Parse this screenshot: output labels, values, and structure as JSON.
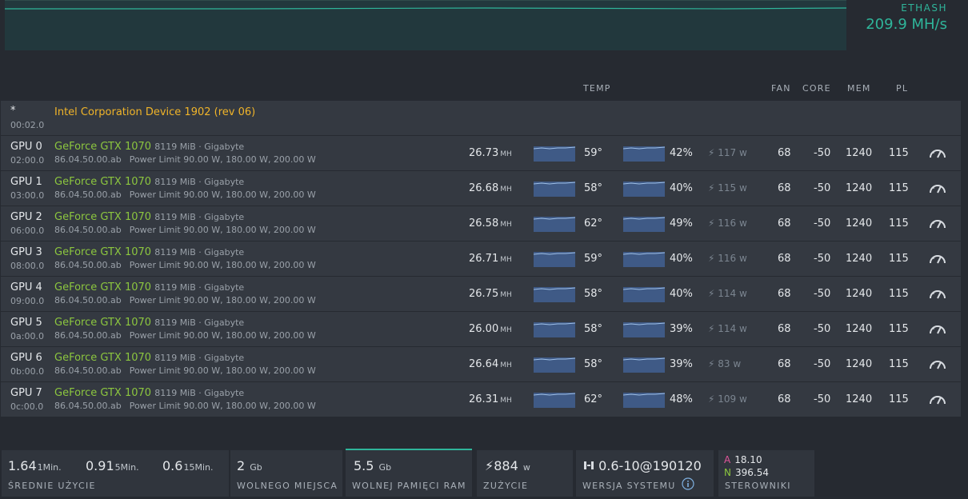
{
  "algo": {
    "name": "ETHASH",
    "hashrate": "209.9 MH/s"
  },
  "columns": {
    "temp": "TEMP",
    "fan": "FAN",
    "core": "CORE",
    "mem": "MEM",
    "pl": "PL"
  },
  "cpu_row": {
    "id": "*",
    "bus": "00:02.0",
    "name": "Intel Corporation Device 1902 (rev 06)"
  },
  "gpus": [
    {
      "id": "GPU 0",
      "bus": "02:00.0",
      "model": "GeForce GTX 1070",
      "mem": "8119 MiB · Gigabyte",
      "bios": "86.04.50.00.ab",
      "power_limit": "Power Limit 90.00 W, 180.00 W, 200.00 W",
      "hashrate": "26.73",
      "unit": "MH",
      "temp": "59°",
      "fan_pct": "42%",
      "power": "117 w",
      "fan": "68",
      "core": "-50",
      "mem_clk": "1240",
      "pl": "115"
    },
    {
      "id": "GPU 1",
      "bus": "03:00.0",
      "model": "GeForce GTX 1070",
      "mem": "8119 MiB · Gigabyte",
      "bios": "86.04.50.00.ab",
      "power_limit": "Power Limit 90.00 W, 180.00 W, 200.00 W",
      "hashrate": "26.68",
      "unit": "MH",
      "temp": "58°",
      "fan_pct": "40%",
      "power": "115 w",
      "fan": "68",
      "core": "-50",
      "mem_clk": "1240",
      "pl": "115"
    },
    {
      "id": "GPU 2",
      "bus": "06:00.0",
      "model": "GeForce GTX 1070",
      "mem": "8119 MiB · Gigabyte",
      "bios": "86.04.50.00.ab",
      "power_limit": "Power Limit 90.00 W, 180.00 W, 200.00 W",
      "hashrate": "26.58",
      "unit": "MH",
      "temp": "62°",
      "fan_pct": "49%",
      "power": "116 w",
      "fan": "68",
      "core": "-50",
      "mem_clk": "1240",
      "pl": "115"
    },
    {
      "id": "GPU 3",
      "bus": "08:00.0",
      "model": "GeForce GTX 1070",
      "mem": "8119 MiB · Gigabyte",
      "bios": "86.04.50.00.ab",
      "power_limit": "Power Limit 90.00 W, 180.00 W, 200.00 W",
      "hashrate": "26.71",
      "unit": "MH",
      "temp": "59°",
      "fan_pct": "40%",
      "power": "116 w",
      "fan": "68",
      "core": "-50",
      "mem_clk": "1240",
      "pl": "115"
    },
    {
      "id": "GPU 4",
      "bus": "09:00.0",
      "model": "GeForce GTX 1070",
      "mem": "8119 MiB · Gigabyte",
      "bios": "86.04.50.00.ab",
      "power_limit": "Power Limit 90.00 W, 180.00 W, 200.00 W",
      "hashrate": "26.75",
      "unit": "MH",
      "temp": "58°",
      "fan_pct": "40%",
      "power": "114 w",
      "fan": "68",
      "core": "-50",
      "mem_clk": "1240",
      "pl": "115"
    },
    {
      "id": "GPU 5",
      "bus": "0a:00.0",
      "model": "GeForce GTX 1070",
      "mem": "8119 MiB · Gigabyte",
      "bios": "86.04.50.00.ab",
      "power_limit": "Power Limit 90.00 W, 180.00 W, 200.00 W",
      "hashrate": "26.00",
      "unit": "MH",
      "temp": "58°",
      "fan_pct": "39%",
      "power": "114 w",
      "fan": "68",
      "core": "-50",
      "mem_clk": "1240",
      "pl": "115"
    },
    {
      "id": "GPU 6",
      "bus": "0b:00.0",
      "model": "GeForce GTX 1070",
      "mem": "8119 MiB · Gigabyte",
      "bios": "86.04.50.00.ab",
      "power_limit": "Power Limit 90.00 W, 180.00 W, 200.00 W",
      "hashrate": "26.64",
      "unit": "MH",
      "temp": "58°",
      "fan_pct": "39%",
      "power": "83 w",
      "fan": "68",
      "core": "-50",
      "mem_clk": "1240",
      "pl": "115"
    },
    {
      "id": "GPU 7",
      "bus": "0c:00.0",
      "model": "GeForce GTX 1070",
      "mem": "8119 MiB · Gigabyte",
      "bios": "86.04.50.00.ab",
      "power_limit": "Power Limit 90.00 W, 180.00 W, 200.00 W",
      "hashrate": "26.31",
      "unit": "MH",
      "temp": "62°",
      "fan_pct": "48%",
      "power": "109 w",
      "fan": "68",
      "core": "-50",
      "mem_clk": "1240",
      "pl": "115"
    }
  ],
  "footer": {
    "load": {
      "v1": "1.64",
      "u1": "1Min.",
      "v5": "0.91",
      "u5": "5Min.",
      "v15": "0.6",
      "u15": "15Min.",
      "label": "ŚREDNIE UŻYCIE"
    },
    "disk": {
      "value": "2",
      "unit": "Gb",
      "label": "WOLNEGO MIEJSCA"
    },
    "ram": {
      "value": "5.5",
      "unit": "Gb",
      "label": "WOLNEJ PAMIĘCI RAM"
    },
    "power": {
      "value": "884",
      "unit": "w",
      "label": "ZUŻYCIE"
    },
    "version": {
      "value": "0.6-10@190120",
      "label": "WERSJA SYSTEMU"
    },
    "drivers": {
      "amd_letter": "A",
      "amd": "18.10",
      "nv_letter": "N",
      "nv": "396.54",
      "label": "STEROWNIKI"
    }
  },
  "colors": {
    "accent": "#2fb59a",
    "nvidia_green": "#8cc63f",
    "intel_yellow": "#f0b429",
    "amd_pink": "#e0559a",
    "row_bg": "#343941",
    "page_bg": "#262a31"
  }
}
